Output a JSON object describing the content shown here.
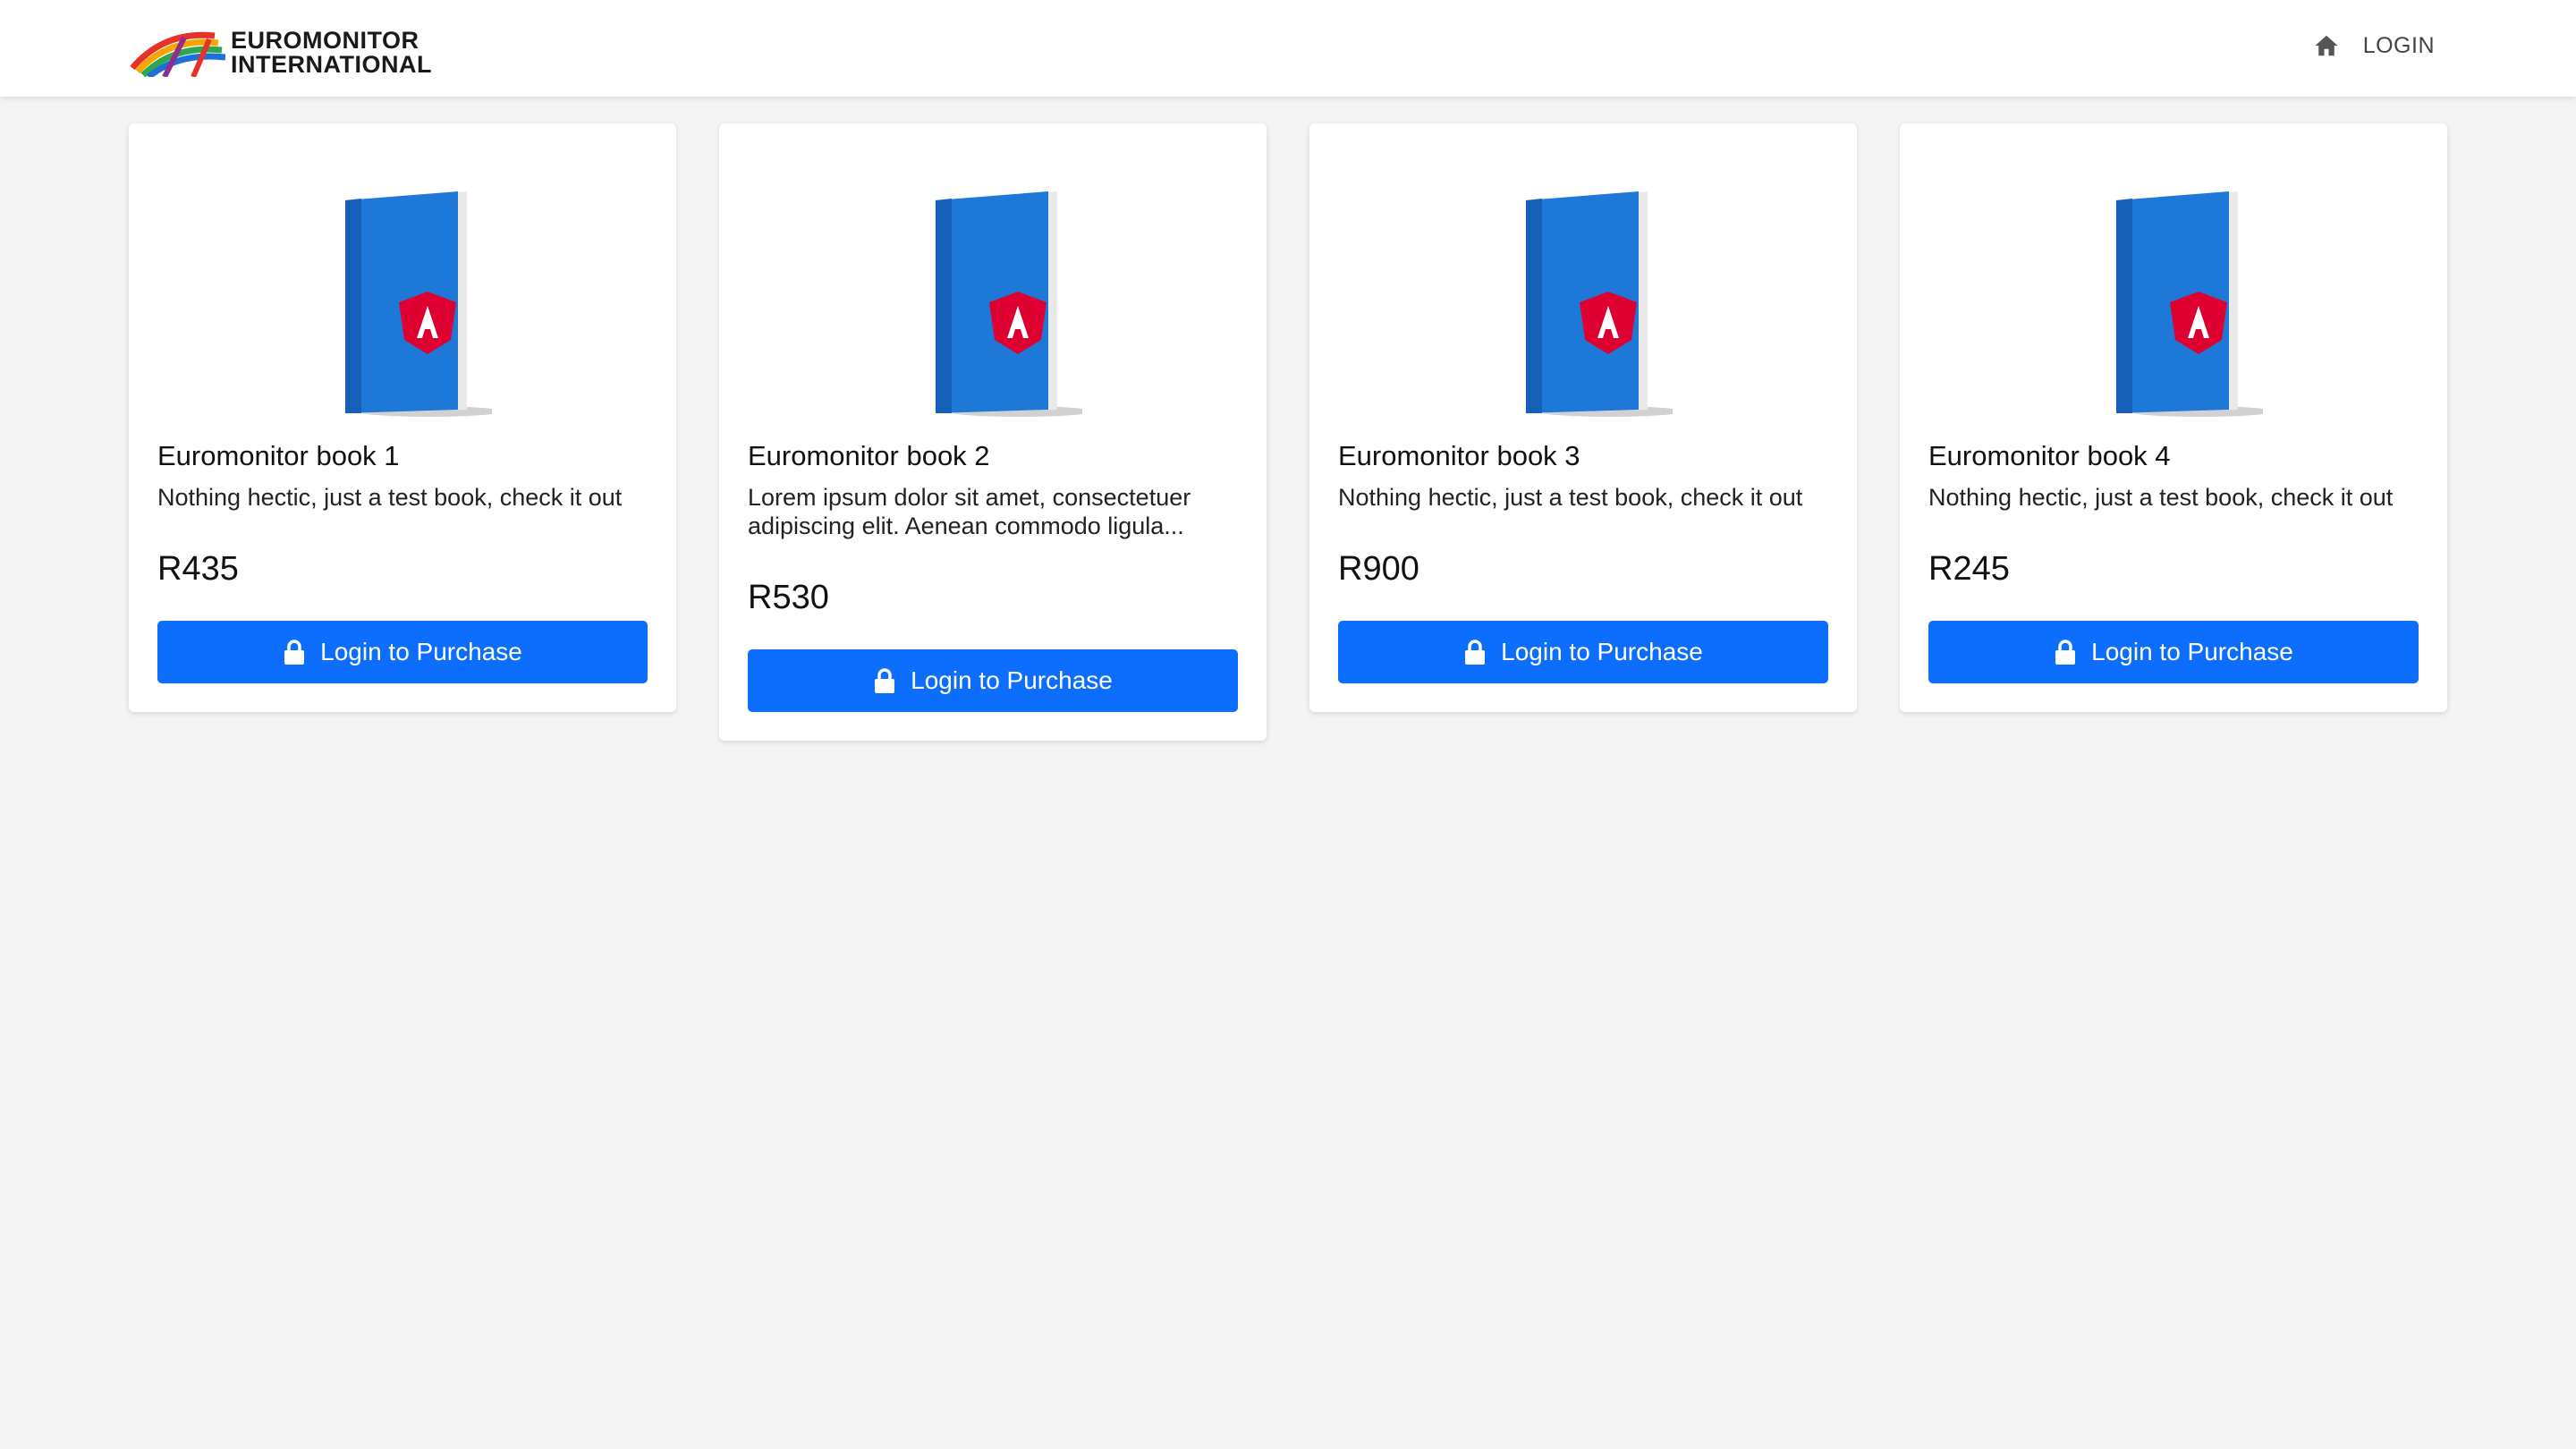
{
  "header": {
    "brand_line1": "EUROMONITOR",
    "brand_line2": "INTERNATIONAL",
    "home_icon": "home-icon",
    "login_label": "LOGIN"
  },
  "books": [
    {
      "title": "Euromonitor book 1",
      "description": "Nothing hectic, just a test book, check it out",
      "price": "R435",
      "button_label": "Login to Purchase"
    },
    {
      "title": "Euromonitor book 2",
      "description": "Lorem ipsum dolor sit amet, consectetuer adipiscing elit. Aenean commodo ligula...",
      "price": "R530",
      "button_label": "Login to Purchase"
    },
    {
      "title": "Euromonitor book 3",
      "description": "Nothing hectic, just a test book, check it out",
      "price": "R900",
      "button_label": "Login to Purchase"
    },
    {
      "title": "Euromonitor book 4",
      "description": "Nothing hectic, just a test book, check it out",
      "price": "R245",
      "button_label": "Login to Purchase"
    }
  ],
  "colors": {
    "accent": "#0d6efd",
    "background": "#f4f4f4",
    "card": "#ffffff",
    "book_cover": "#1e78d8",
    "angular_shield": "#dd0031"
  }
}
